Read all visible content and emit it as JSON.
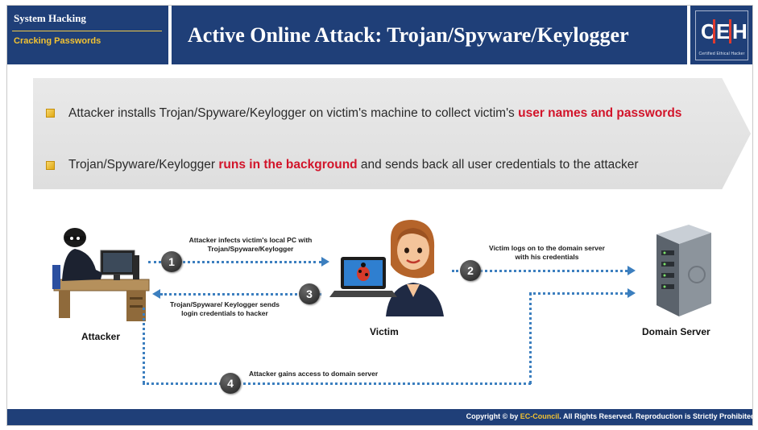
{
  "header": {
    "section": "System Hacking",
    "subsection": "Cracking Passwords",
    "title": "Active Online Attack: Trojan/Spyware/Keylogger",
    "logo": {
      "c": "C",
      "e": "E",
      "h": "H",
      "sub": "Certified  Ethical  Hacker"
    }
  },
  "bullets": [
    {
      "pre": "Attacker installs Trojan/Spyware/Keylogger on victim's machine to collect victim's ",
      "highlight": "user names and passwords",
      "post": ""
    },
    {
      "pre": "Trojan/Spyware/Keylogger ",
      "highlight": "runs in the background",
      "post": " and sends back all user credentials to the attacker"
    }
  ],
  "diagram": {
    "attacker_label": "Attacker",
    "victim_label": "Victim",
    "server_label": "Domain Server",
    "steps": [
      {
        "num": "1",
        "text": "Attacker infects victim's local PC with Trojan/Spyware/Keylogger"
      },
      {
        "num": "2",
        "text": "Victim logs on to the domain server with his credentials"
      },
      {
        "num": "3",
        "text": "Trojan/Spyware/ Keylogger sends login credentials to hacker"
      },
      {
        "num": "4",
        "text": "Attacker gains access to domain server"
      }
    ]
  },
  "footer": {
    "pre": "Copyright © by ",
    "brand": "EC-Council",
    "post": ". All Rights Reserved. Reproduction is Strictly Prohibited."
  },
  "colors": {
    "header_bg": "#1f3f78",
    "highlight": "#d2142a",
    "arrow": "#3c7fbf",
    "accent": "#f2c232"
  },
  "icons": [
    "bullet-square-icon",
    "attacker-at-computer-icon",
    "victim-with-laptop-icon",
    "domain-server-icon"
  ]
}
